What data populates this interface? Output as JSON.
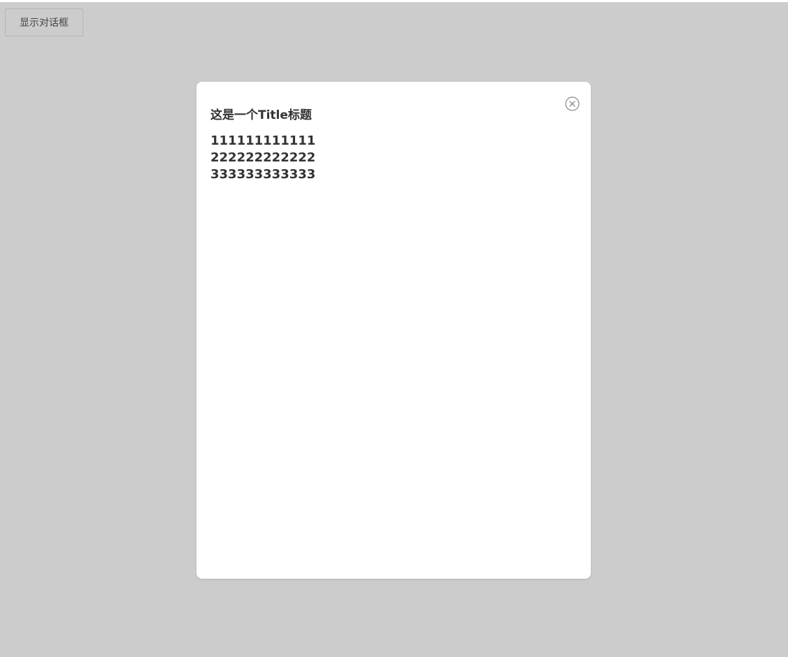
{
  "toolbar": {
    "show_dialog_label": "显示对话框"
  },
  "dialog": {
    "title": "这是一个Title标题",
    "lines": [
      "111111111111",
      "222222222222",
      "333333333333"
    ],
    "close_icon": "close-circle-icon"
  },
  "colors": {
    "overlay": "#cccccc",
    "dialog_background": "#ffffff",
    "text": "#333333",
    "icon": "#888888"
  }
}
